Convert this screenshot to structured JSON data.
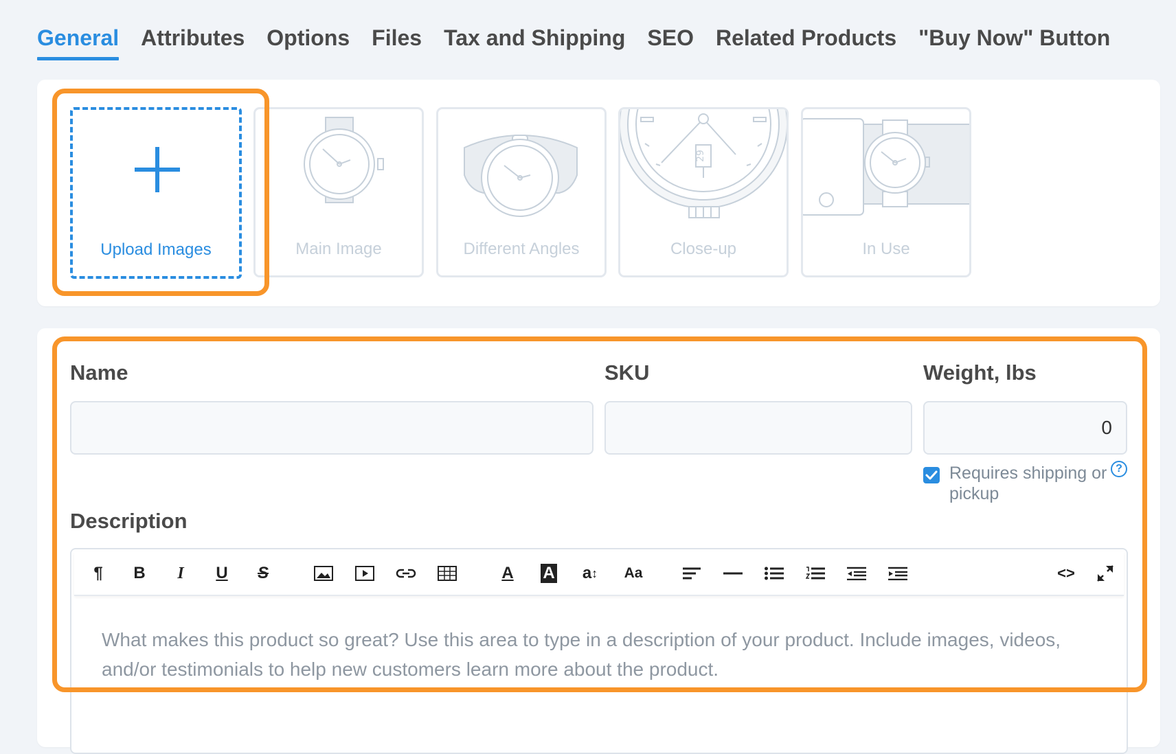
{
  "tabs": [
    "General",
    "Attributes",
    "Options",
    "Files",
    "Tax and Shipping",
    "SEO",
    "Related Products",
    "\"Buy Now\" Button"
  ],
  "active_tab": "General",
  "images": {
    "upload_label": "Upload Images",
    "tiles": [
      "Main Image",
      "Different Angles",
      "Close-up",
      "In Use"
    ],
    "closeup_date": "29"
  },
  "form": {
    "name_label": "Name",
    "name_value": "",
    "sku_label": "SKU",
    "sku_value": "",
    "weight_label": "Weight, lbs",
    "weight_value": "0",
    "requires_shipping_label": "Requires shipping or pickup",
    "requires_shipping_checked": true,
    "help_glyph": "?",
    "description_label": "Description",
    "description_placeholder": "What makes this product so great? Use this area to type in a description of your product. Include images, videos, and/or testimonials to help new customers learn more about the product."
  },
  "toolbar": {
    "paragraph": "¶",
    "bold": "B",
    "italic": "I",
    "underline": "U",
    "strikethrough": "S",
    "font_color": "A",
    "background_color": "A",
    "font_size": "a",
    "text_transform": "Aa",
    "code": "<>",
    "buttons": [
      "paragraph-icon",
      "bold-icon",
      "italic-icon",
      "underline-icon",
      "strikethrough-icon",
      "insert-image-icon",
      "insert-video-icon",
      "insert-link-icon",
      "insert-table-icon",
      "font-color-icon",
      "background-color-icon",
      "font-size-icon",
      "text-transform-icon",
      "align-left-icon",
      "horizontal-rule-icon",
      "bulleted-list-icon",
      "numbered-list-icon",
      "outdent-icon",
      "indent-icon",
      "code-view-icon",
      "fullscreen-icon"
    ]
  },
  "colors": {
    "accent": "#2a8de0",
    "highlight": "#f8952a",
    "background": "#f1f4f8",
    "muted_illustration": "#c6d0da"
  }
}
